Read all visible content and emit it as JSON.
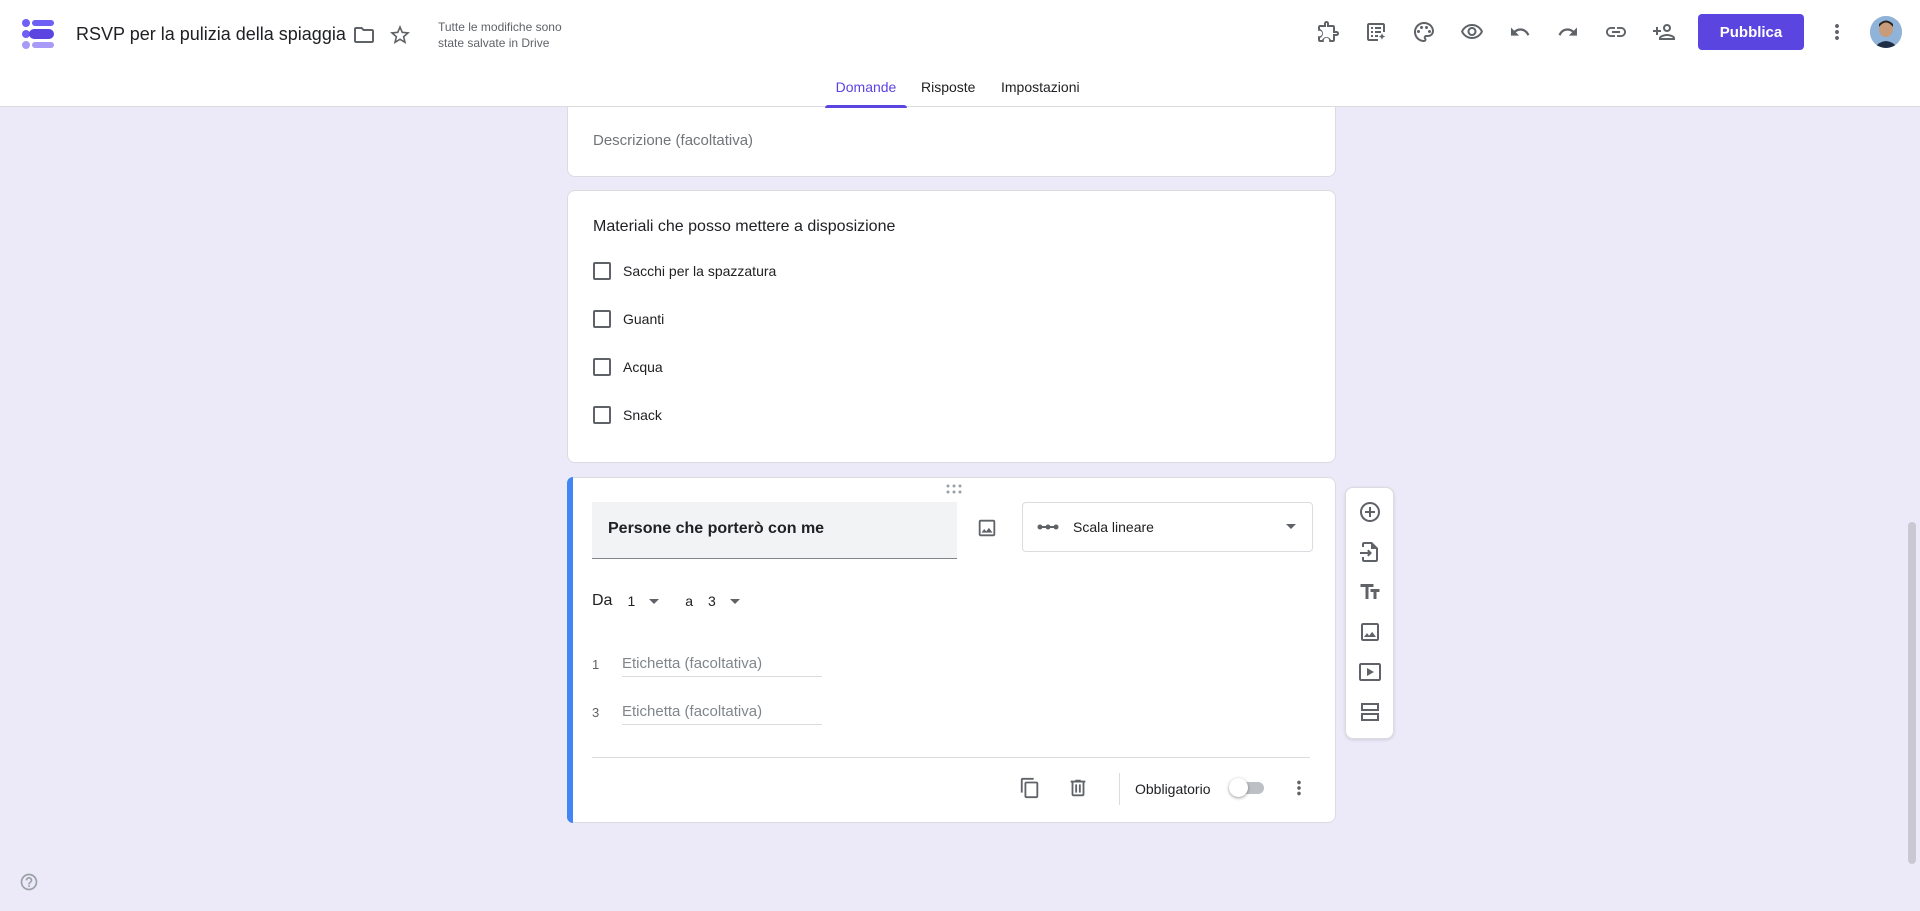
{
  "header": {
    "title": "RSVP per la pulizia della spiaggia",
    "save_status": "Tutte le modifiche sono state salvate in Drive",
    "publish_label": "Pubblica",
    "tabs": [
      {
        "label": "Domande",
        "active": true
      },
      {
        "label": "Risposte",
        "active": false
      },
      {
        "label": "Impostazioni",
        "active": false
      }
    ]
  },
  "section_card": {
    "description_placeholder": "Descrizione (facoltativa)"
  },
  "question_checkbox": {
    "title": "Materiali che posso mettere a disposizione",
    "options": [
      "Sacchi per la spazzatura",
      "Guanti",
      "Acqua",
      "Snack"
    ]
  },
  "question_scale": {
    "title": "Persone che porterò con me",
    "type_label": "Scala lineare",
    "range_from_label": "Da",
    "range_from_value": "1",
    "range_to_label": "a",
    "range_to_value": "3",
    "label_rows": [
      {
        "num": "1",
        "placeholder": "Etichetta (facoltativa)"
      },
      {
        "num": "3",
        "placeholder": "Etichetta (facoltativa)"
      }
    ],
    "required_label": "Obbligatorio",
    "required": false
  },
  "colors": {
    "accent": "#5b45e0",
    "background": "#eceaf9",
    "active_question_bar": "#4285f4"
  },
  "icons": {
    "header": [
      "folder-icon",
      "star-icon",
      "addons-icon",
      "customize-icon",
      "palette-icon",
      "preview-icon",
      "undo-icon",
      "redo-icon",
      "link-icon",
      "add-collaborator-icon",
      "more-vert-icon"
    ],
    "floating_toolbar": [
      "add-question-icon",
      "import-questions-icon",
      "add-title-icon",
      "add-image-icon",
      "add-video-icon",
      "add-section-icon"
    ]
  }
}
